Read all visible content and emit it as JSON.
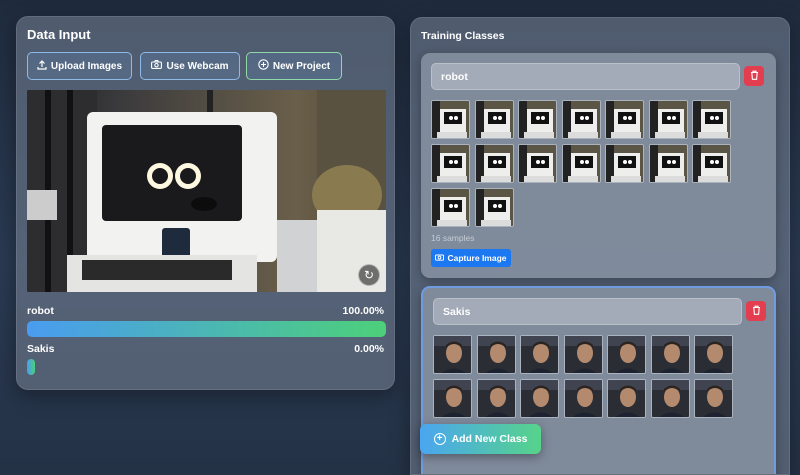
{
  "data_input": {
    "title": "Data Input",
    "upload_label": "Upload Images",
    "webcam_label": "Use Webcam",
    "new_project_label": "New Project"
  },
  "predictions": [
    {
      "label": "robot",
      "percent_text": "100.00%",
      "value": 1.0
    },
    {
      "label": "Sakis",
      "percent_text": "0.00%",
      "value": 0.0
    }
  ],
  "training": {
    "title": "Training Classes",
    "classes": [
      {
        "name": "robot",
        "samples_text": "16 samples",
        "sample_count": 16,
        "capture_label": "Capture Image"
      },
      {
        "name": "Sakis",
        "sample_count": 14
      }
    ],
    "add_class_label": "Add New Class"
  },
  "colors": {
    "accent_blue": "#1b78f0",
    "delete_red": "#e23e4f",
    "gradient_start": "#4a9cf0",
    "gradient_end": "#4cd07a"
  },
  "icons": {
    "upload": "upload-icon",
    "camera": "camera-icon",
    "new_project": "plus-circle-icon",
    "delete": "trash-icon",
    "switch_camera": "refresh-icon",
    "add": "plus-circle-icon"
  }
}
